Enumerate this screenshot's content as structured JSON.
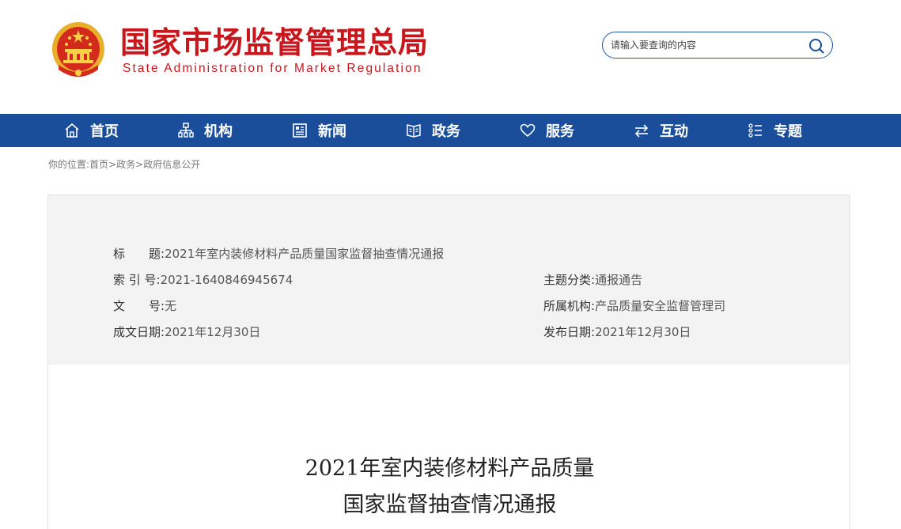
{
  "header": {
    "title_cn": "国家市场监督管理总局",
    "title_en": "State Administration for Market Regulation",
    "emblem_icon": "national-emblem-icon"
  },
  "search": {
    "placeholder": "请输入要查询的内容",
    "icon": "search-icon"
  },
  "nav": {
    "items": [
      {
        "label": "首页",
        "icon": "home-icon"
      },
      {
        "label": "机构",
        "icon": "org-chart-icon"
      },
      {
        "label": "新闻",
        "icon": "newspaper-icon"
      },
      {
        "label": "政务",
        "icon": "book-icon"
      },
      {
        "label": "服务",
        "icon": "heart-icon"
      },
      {
        "label": "互动",
        "icon": "swap-arrows-icon"
      },
      {
        "label": "专题",
        "icon": "list-icon"
      }
    ]
  },
  "breadcrumb": {
    "prefix": "你的位置:",
    "items": [
      "首页",
      "政务",
      "政府信息公开"
    ],
    "separator": ">"
  },
  "meta": {
    "title_label": "标　　题:",
    "title_value": "2021年室内装修材料产品质量国家监督抽查情况通报",
    "index_label": "索 引 号:",
    "index_value": "2021-1640846945674",
    "topic_label": "主题分类:",
    "topic_value": "通报通告",
    "docno_label": "文　　号:",
    "docno_value": "无",
    "org_label": "所属机构:",
    "org_value": "产品质量安全监督管理司",
    "written_label": "成文日期:",
    "written_value": "2021年12月30日",
    "publish_label": "发布日期:",
    "publish_value": "2021年12月30日"
  },
  "article": {
    "title_line1": "2021年室内装修材料产品质量",
    "title_line2": "国家监督抽查情况通报"
  },
  "colors": {
    "brand_red": "#c8161d",
    "nav_blue": "#1a4e9b",
    "panel_gray": "#f3f3f3"
  }
}
